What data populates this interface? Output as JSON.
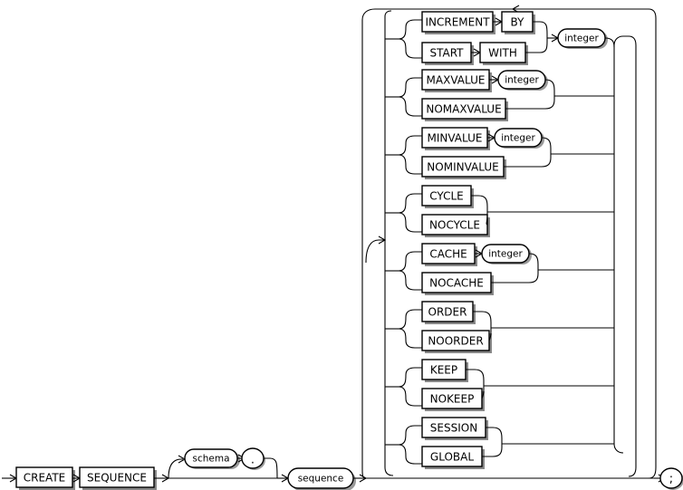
{
  "diagram": {
    "title": "CREATE SEQUENCE",
    "type": "railroad-syntax-diagram",
    "stroke_color": "#000000",
    "background_color": "#ffffff",
    "terminator": ";",
    "main_sequence": [
      {
        "kind": "terminal",
        "label": "CREATE"
      },
      {
        "kind": "terminal",
        "label": "SEQUENCE"
      },
      {
        "kind": "nonterminal",
        "label": "schema",
        "optional": true
      },
      {
        "kind": "punct",
        "label": "."
      },
      {
        "kind": "nonterminal",
        "label": "sequence"
      }
    ],
    "options_groups": [
      {
        "id": "increment-start",
        "alternatives": [
          {
            "terminals": [
              "INCREMENT",
              "BY"
            ]
          },
          {
            "terminals": [
              "START",
              "WITH"
            ]
          }
        ],
        "argument": "integer"
      },
      {
        "id": "maxvalue",
        "alternatives": [
          {
            "terminals": [
              "MAXVALUE"
            ],
            "argument": "integer"
          },
          {
            "terminals": [
              "NOMAXVALUE"
            ]
          }
        ]
      },
      {
        "id": "minvalue",
        "alternatives": [
          {
            "terminals": [
              "MINVALUE"
            ],
            "argument": "integer"
          },
          {
            "terminals": [
              "NOMINVALUE"
            ]
          }
        ]
      },
      {
        "id": "cycle",
        "alternatives": [
          {
            "terminals": [
              "CYCLE"
            ]
          },
          {
            "terminals": [
              "NOCYCLE"
            ]
          }
        ]
      },
      {
        "id": "cache",
        "alternatives": [
          {
            "terminals": [
              "CACHE"
            ],
            "argument": "integer"
          },
          {
            "terminals": [
              "NOCACHE"
            ]
          }
        ]
      },
      {
        "id": "order",
        "alternatives": [
          {
            "terminals": [
              "ORDER"
            ]
          },
          {
            "terminals": [
              "NOORDER"
            ]
          }
        ]
      },
      {
        "id": "keep",
        "alternatives": [
          {
            "terminals": [
              "KEEP"
            ]
          },
          {
            "terminals": [
              "NOKEEP"
            ]
          }
        ]
      },
      {
        "id": "scope",
        "alternatives": [
          {
            "terminals": [
              "SESSION"
            ]
          },
          {
            "terminals": [
              "GLOBAL"
            ]
          }
        ]
      }
    ],
    "labels": {
      "create": "CREATE",
      "sequence_kw": "SEQUENCE",
      "schema": "schema",
      "dot": ".",
      "sequence_name": "sequence",
      "increment": "INCREMENT",
      "by": "BY",
      "start": "START",
      "with": "WITH",
      "integer_1": "integer",
      "maxvalue": "MAXVALUE",
      "integer_2": "integer",
      "nomaxvalue": "NOMAXVALUE",
      "minvalue": "MINVALUE",
      "integer_3": "integer",
      "nominvalue": "NOMINVALUE",
      "cycle": "CYCLE",
      "nocycle": "NOCYCLE",
      "cache": "CACHE",
      "integer_4": "integer",
      "nocache": "NOCACHE",
      "order": "ORDER",
      "noorder": "NOORDER",
      "keep": "KEEP",
      "nokeep": "NOKEEP",
      "session": "SESSION",
      "global": "GLOBAL",
      "semicolon": ";"
    }
  }
}
